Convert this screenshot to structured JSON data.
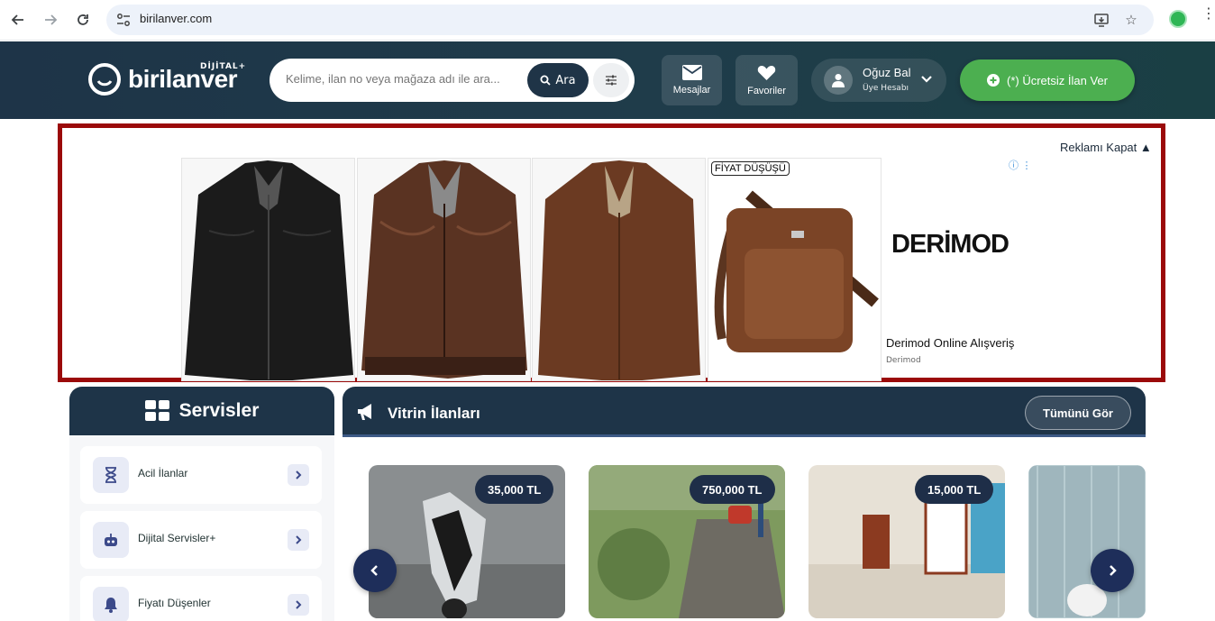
{
  "browser": {
    "url": "birilanver.com"
  },
  "header": {
    "logo_text": "birilanver",
    "logo_sub": "DİJİTAL+",
    "search_placeholder": "Kelime, ilan no veya mağaza adı ile ara...",
    "search_button": "Ara",
    "messages_label": "Mesajlar",
    "favorites_label": "Favoriler",
    "user_name": "Oğuz Bal",
    "user_role": "Üye Hesabı",
    "post_button": "(*) Ücretsiz İlan Ver"
  },
  "ad": {
    "close_label": "Reklamı Kapat",
    "badge": "FİYAT DÜŞÜŞÜ",
    "brand": "DERİMOD",
    "brand_title": "Derimod Online Alışveriş",
    "brand_sub": "Derimod"
  },
  "services": {
    "title": "Servisler",
    "items": [
      {
        "label": "Acil İlanlar"
      },
      {
        "label": "Dijital Servisler+"
      },
      {
        "label": "Fiyatı Düşenler"
      }
    ]
  },
  "showcase": {
    "title": "Vitrin İlanları",
    "see_all": "Tümünü Gör",
    "listings": [
      {
        "price": "35,000 TL"
      },
      {
        "price": "750,000 TL"
      },
      {
        "price": "15,000 TL"
      }
    ]
  },
  "colors": {
    "header_bg": "#1e3448",
    "post_green": "#4caf50",
    "ad_border": "#9b0a0a"
  }
}
